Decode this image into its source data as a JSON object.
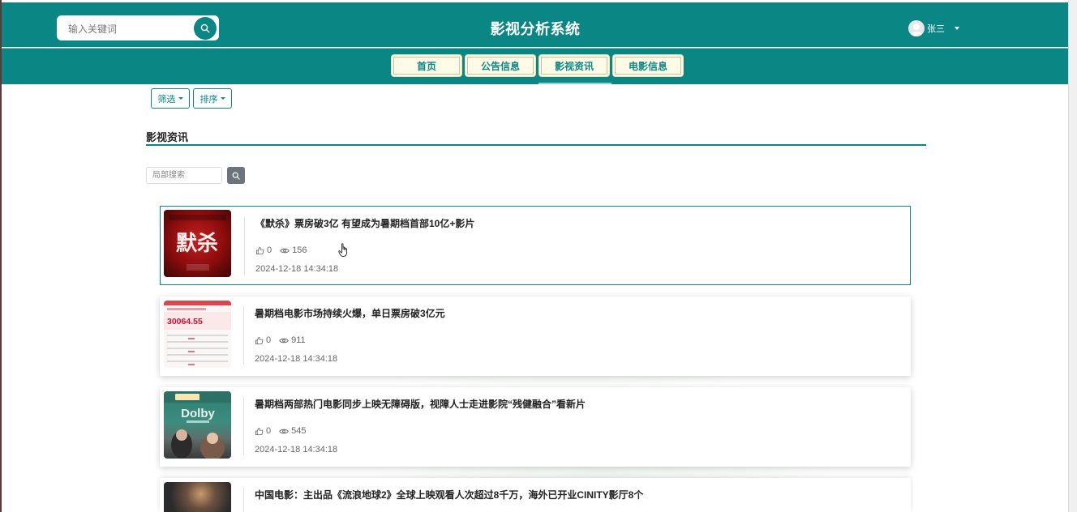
{
  "header": {
    "search_placeholder": "输入关键词",
    "site_title": "影视分析系统",
    "user_name": "张三"
  },
  "nav": {
    "items": [
      {
        "label": "首页"
      },
      {
        "label": "公告信息"
      },
      {
        "label": "影视资讯"
      },
      {
        "label": "电影信息"
      }
    ],
    "active": "影视资讯"
  },
  "toolbar": {
    "filter_label": "筛选",
    "sort_label": "排序"
  },
  "section": {
    "title": "影视资讯",
    "local_search_placeholder": "局部搜索"
  },
  "news": [
    {
      "title": "《默杀》票房破3亿 有望成为暑期档首部10亿+影片",
      "likes": "0",
      "views": "156",
      "date": "2024-12-18 14:34:18",
      "thumb_text": "默杀"
    },
    {
      "title": "暑期档电影市场持续火爆，单日票房破3亿元",
      "likes": "0",
      "views": "911",
      "date": "2024-12-18 14:34:18",
      "thumb_text": "30064.55"
    },
    {
      "title": "暑期档两部热门电影同步上映无障碍版，视障人士走进影院“残健融合”看新片",
      "likes": "0",
      "views": "545",
      "date": "2024-12-18 14:34:18",
      "thumb_text": "Dolby"
    },
    {
      "title": "中国电影：主出品《流浪地球2》全球上映观看人次超过8千万，海外已开业CINITY影厅8个",
      "likes": "",
      "views": "",
      "date": "",
      "thumb_text": ""
    }
  ],
  "colors": {
    "primary": "#0a8784",
    "nav_button_bg": "#fffbe6"
  }
}
